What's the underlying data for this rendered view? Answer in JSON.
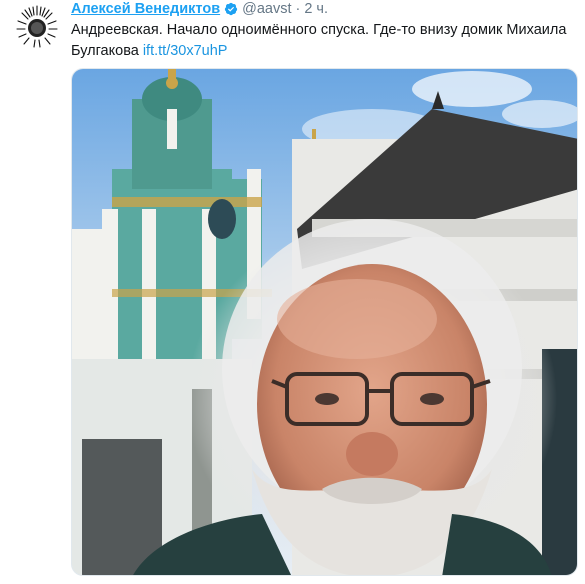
{
  "tweet": {
    "author_name": "Алексей Венедиктов",
    "handle": "@aavst",
    "separator": "·",
    "timestamp": "2 ч.",
    "text": "Андреевская. Начало одноимённого спуска. Где-то внизу домик Михаила Булгакова ",
    "link": "ift.tt/30x7uhP"
  },
  "icons": {
    "verified": "verified-badge-icon",
    "avatar": "user-avatar"
  },
  "colors": {
    "name": "#1da1f2",
    "link": "#1b95e0",
    "secondary": "#657786",
    "sky": "#7bb2e6",
    "church_green": "#4f9a8f",
    "gold": "#c9a44a"
  }
}
